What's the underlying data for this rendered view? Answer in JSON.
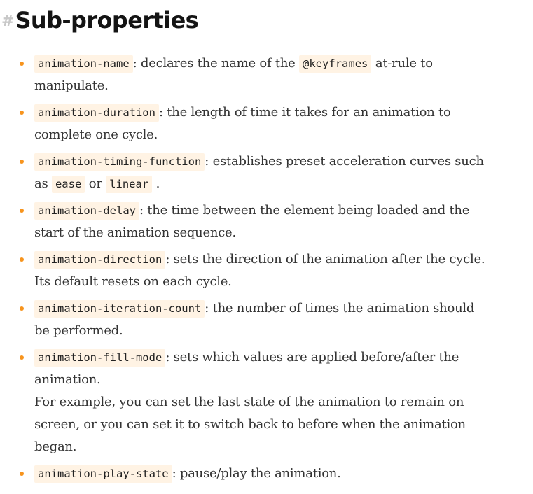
{
  "heading": {
    "hash": "#",
    "title": "Sub-properties"
  },
  "items": [
    {
      "code": "animation-name",
      "l1_a": ": declares the name of the ",
      "l1_code": "@keyframes",
      "l1_b": " at-rule to",
      "l2": "manipulate."
    },
    {
      "code": "animation-duration",
      "l1": ": the length of time it takes for an animation to",
      "l2": "complete one cycle."
    },
    {
      "code": "animation-timing-function",
      "l1": ": establishes preset acceleration curves such",
      "l2_a": "as ",
      "l2_code1": "ease",
      "l2_mid": " or ",
      "l2_code2": "linear",
      "l2_end": " ."
    },
    {
      "code": "animation-delay",
      "l1": ": the time between the element being loaded and the",
      "l2": "start of the animation sequence."
    },
    {
      "code": "animation-direction",
      "l1": ": sets the direction of the animation after the cycle.",
      "l2": "Its default resets on each cycle."
    },
    {
      "code": "animation-iteration-count",
      "l1": ": the number of times the animation should",
      "l2": "be performed."
    },
    {
      "code": "animation-fill-mode",
      "l1": ": sets which values are applied before/after the",
      "l2": "animation.",
      "l3": "For example, you can set the last state of the animation to remain on",
      "l4": "screen, or you can set it to switch back to before when the animation",
      "l5": "began."
    },
    {
      "code": "animation-play-state",
      "l1": ": pause/play the animation."
    }
  ],
  "colors": {
    "bullet": "#f7941d",
    "code_bg": "#fff3e4",
    "text": "#333333",
    "title": "#141414",
    "hash": "#c8c8c8"
  }
}
